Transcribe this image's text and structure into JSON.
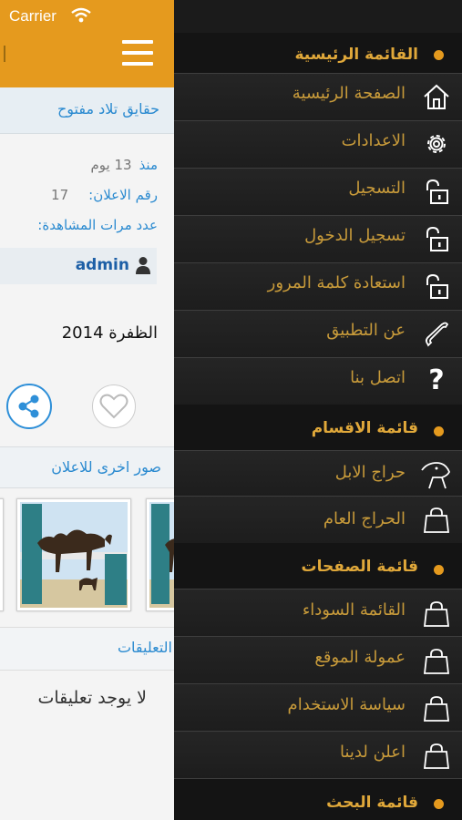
{
  "status_bar": {
    "carrier": "Carrier"
  },
  "ad": {
    "title": "حقايق تلاد مفتوح",
    "since_label": "منذ",
    "since_value": "13 يوم",
    "number_label": "رقم الاعلان:",
    "number_value": "17",
    "views_label": "عدد مرات المشاهدة:",
    "views_value": "",
    "user": "admin",
    "city": "الظفرة 2014",
    "more_photos_title": "صور اخرى للاعلان",
    "comments_title": "التعليقات",
    "no_comments": "لا يوجد تعليقات"
  },
  "menu": {
    "sections": [
      {
        "label": "القائمة الرئيسية",
        "items": [
          {
            "label": "الصفحة الرئيسية",
            "icon": "home-icon"
          },
          {
            "label": "الاعدادات",
            "icon": "gear-icon"
          },
          {
            "label": "التسجيل",
            "icon": "lock-icon"
          },
          {
            "label": "تسجيل الدخول",
            "icon": "lock-icon"
          },
          {
            "label": "استعادة كلمة المرور",
            "icon": "lock-icon"
          },
          {
            "label": "عن التطبيق",
            "icon": "phone-icon"
          },
          {
            "label": "اتصل بنا",
            "icon": "question-icon"
          }
        ]
      },
      {
        "label": "قائمة الاقسام",
        "items": [
          {
            "label": "حراج الابل",
            "icon": "camel-icon"
          },
          {
            "label": "الحراج العام",
            "icon": "bag-icon"
          }
        ]
      },
      {
        "label": "قائمة الصفحات",
        "items": [
          {
            "label": "القائمة السوداء",
            "icon": "bag-icon"
          },
          {
            "label": "عمولة الموقع",
            "icon": "bag-icon"
          },
          {
            "label": "سياسة الاستخدام",
            "icon": "bag-icon"
          },
          {
            "label": "اعلن لدينا",
            "icon": "bag-icon"
          }
        ]
      },
      {
        "label": "قائمة البحث",
        "items": []
      }
    ]
  },
  "colors": {
    "accent": "#e59a1e",
    "menu_text": "#c79a3a",
    "link_blue": "#2a8ad0"
  }
}
